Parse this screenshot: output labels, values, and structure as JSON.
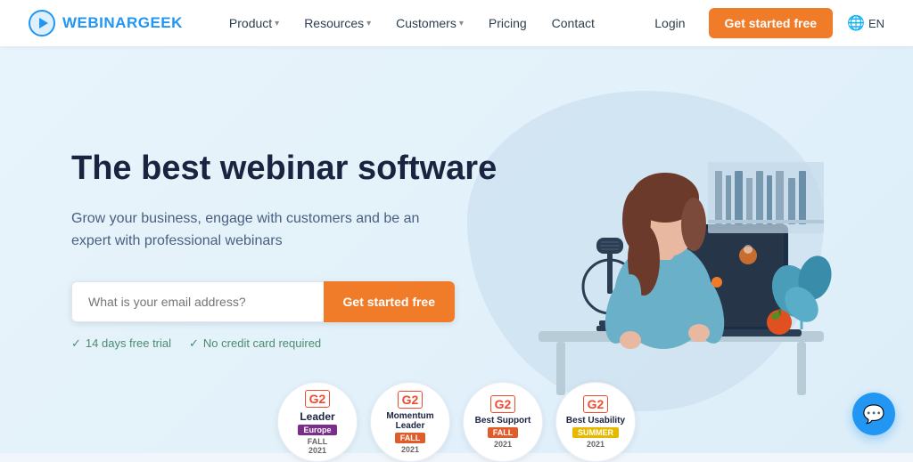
{
  "logo": {
    "text_part1": "WEBINAR",
    "text_part2": "GEEK"
  },
  "nav": {
    "items": [
      {
        "label": "Product",
        "has_dropdown": true
      },
      {
        "label": "Resources",
        "has_dropdown": true
      },
      {
        "label": "Customers",
        "has_dropdown": true
      },
      {
        "label": "Pricing",
        "has_dropdown": false
      },
      {
        "label": "Contact",
        "has_dropdown": false
      }
    ],
    "login_label": "Login",
    "cta_label": "Get started free",
    "lang_label": "EN"
  },
  "hero": {
    "title": "The best webinar software",
    "subtitle": "Grow your business, engage with customers and be an expert with professional webinars",
    "email_placeholder": "What is your email address?",
    "cta_label": "Get started free",
    "trust_items": [
      {
        "text": "14 days free trial"
      },
      {
        "text": "No credit card required"
      }
    ]
  },
  "awards": [
    {
      "title": "Leader",
      "region": "Europe",
      "season": "FALL",
      "year": "2021",
      "badge_color": "#7b2d8b"
    },
    {
      "title": "Momentum Leader",
      "season": "FALL",
      "year": "2021",
      "badge_color": "#e05c2a"
    },
    {
      "title": "Best Support",
      "season": "FALL",
      "year": "2021",
      "badge_color": "#e05c2a"
    },
    {
      "title": "Best Usability",
      "season": "SUMMER",
      "year": "2021",
      "badge_color": "#e6b800"
    }
  ],
  "chat_button": {
    "label": "Chat"
  }
}
